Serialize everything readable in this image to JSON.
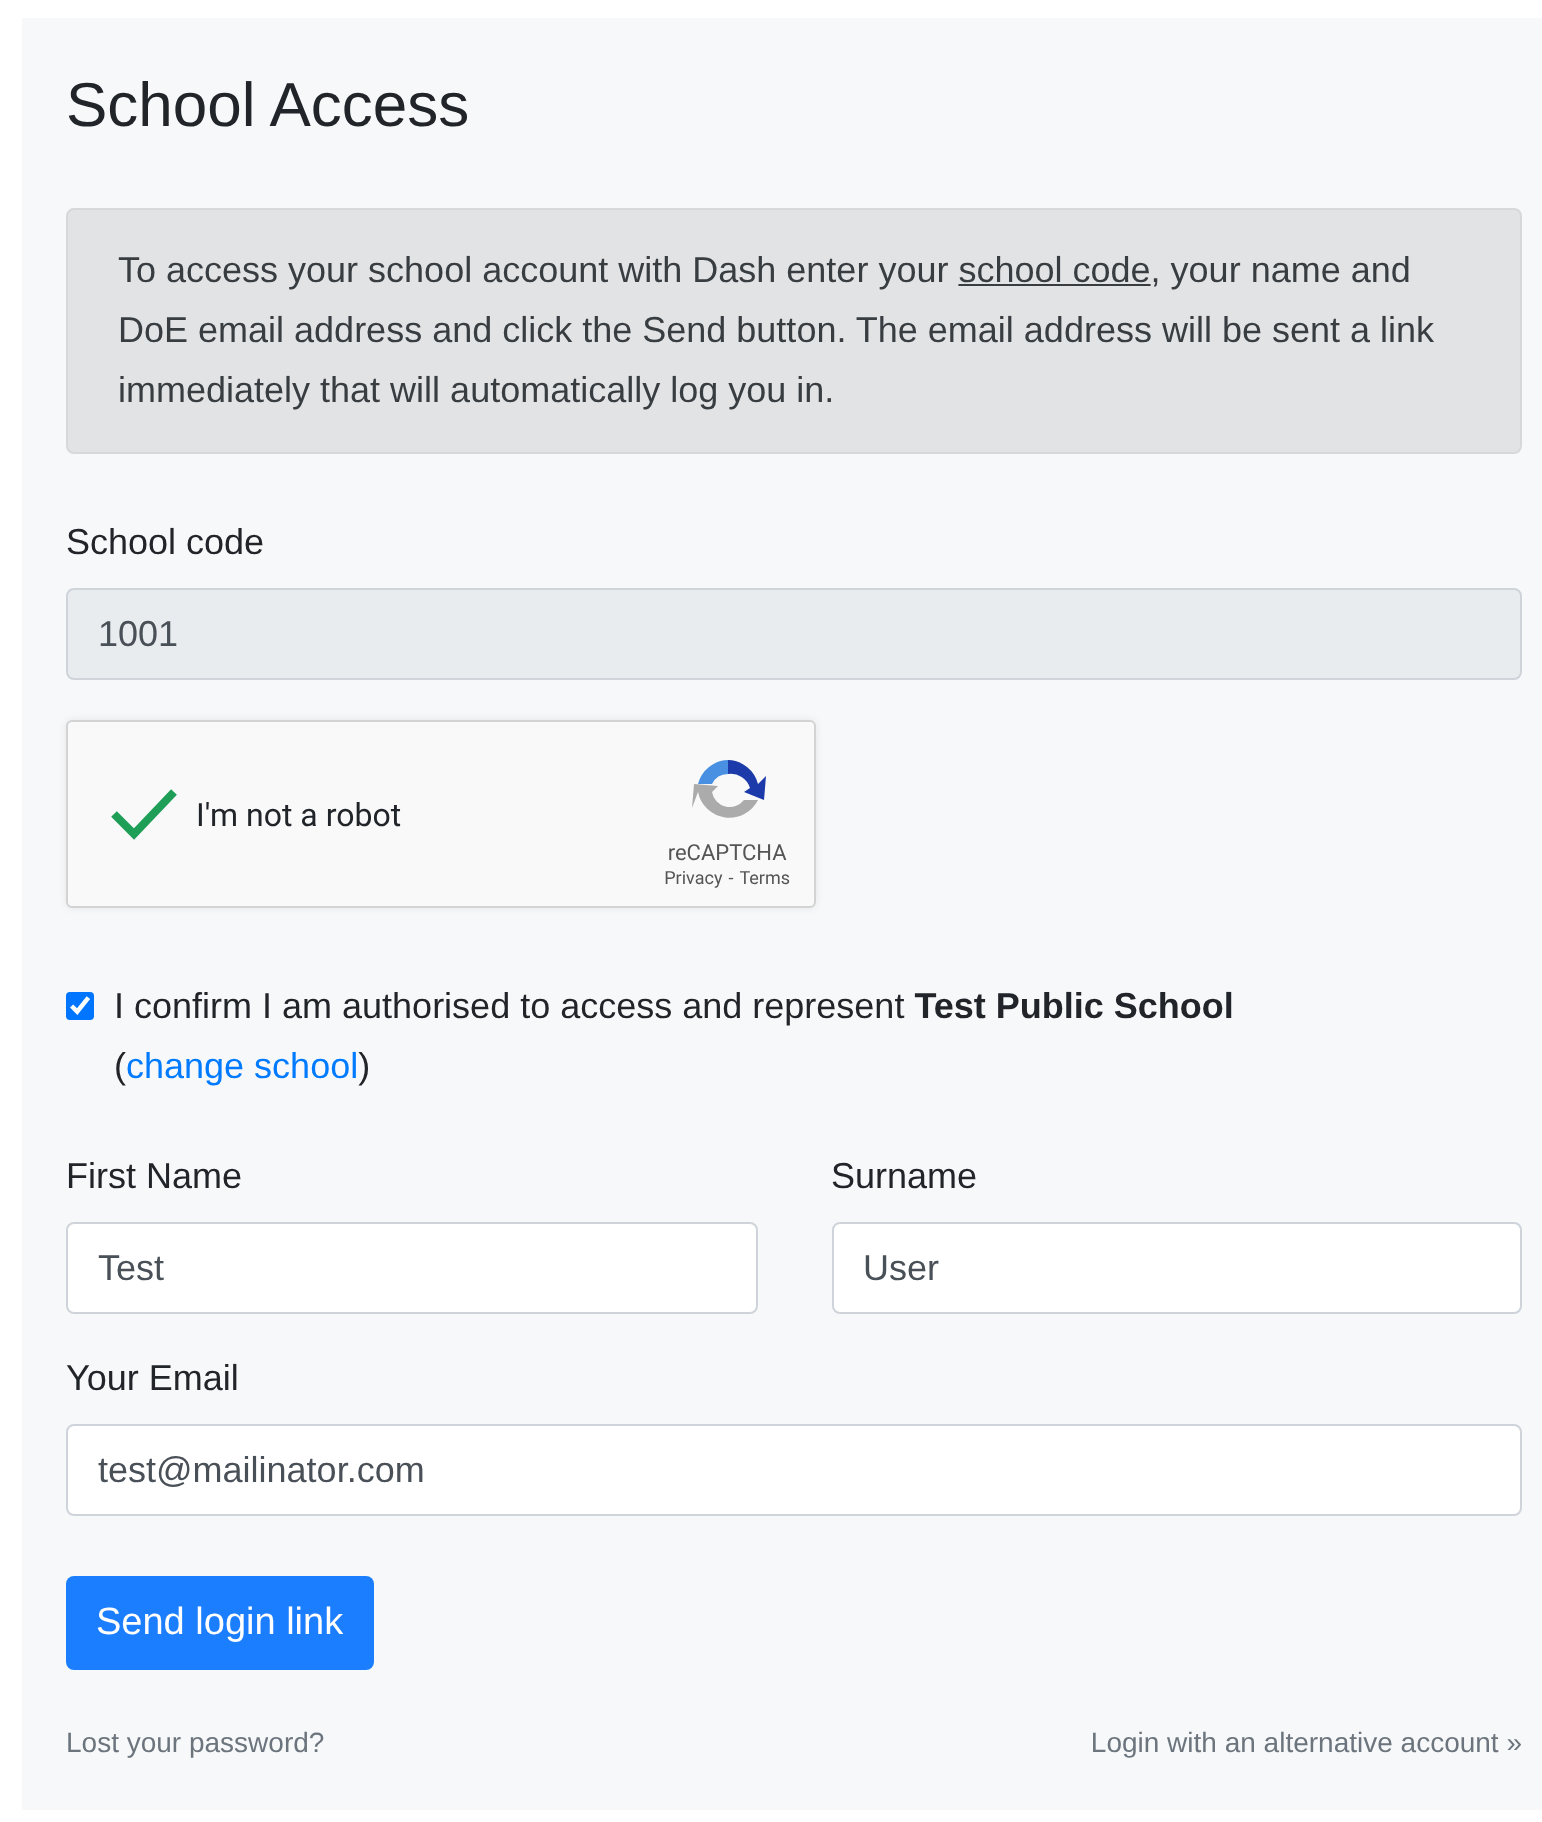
{
  "title": "School Access",
  "info": {
    "before": "To access your school account with Dash enter your ",
    "link": "school code",
    "after": ", your name and DoE email address and click the Send button. The email address will be sent a link immediately that will automatically log you in."
  },
  "school_code": {
    "label": "School code",
    "value": "1001",
    "disabled": true
  },
  "captcha": {
    "checked": true,
    "label": "I'm not a robot",
    "brand": "reCAPTCHA",
    "privacy": "Privacy",
    "separator": "-",
    "terms": "Terms"
  },
  "confirm": {
    "checked": true,
    "text": "I confirm I am authorised to access and represent **Test Public School**",
    "link_prefix": "(",
    "link": "change school",
    "link_suffix": ")"
  },
  "first_name": {
    "label": "First Name",
    "value": "Test"
  },
  "surname": {
    "label": "Surname",
    "value": "User"
  },
  "email": {
    "label": "Your Email",
    "value": "test@mailinator.com"
  },
  "submit": "Send login link",
  "footer": {
    "left": "Lost your password?",
    "right": "Login with an alternative account »"
  }
}
